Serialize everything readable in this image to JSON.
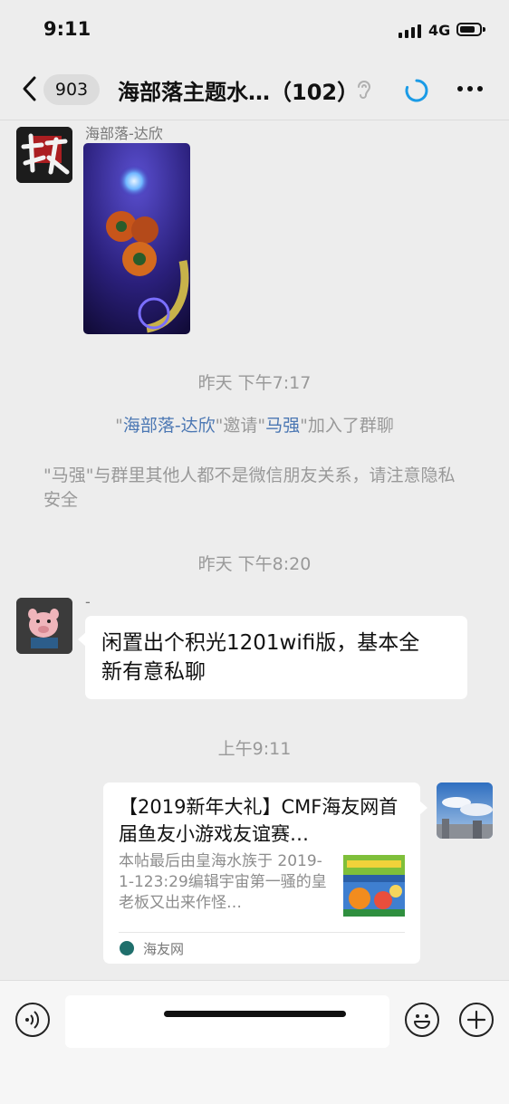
{
  "status_bar": {
    "time": "9:11",
    "network": "4G"
  },
  "nav": {
    "unread_badge": "903",
    "title": "海部落主题水…（102）"
  },
  "messages": {
    "photo": {
      "sender_name": "海部落-达欣"
    },
    "time_1": "昨天 下午7:17",
    "invite": {
      "quote_open": "\"",
      "inviter": "海部落-达欣",
      "mid": "\"邀请\"",
      "invitee": "马强",
      "tail": "\"加入了群聊"
    },
    "privacy_notice": "\"马强\"与群里其他人都不是微信朋友关系，请注意隐私安全",
    "time_2": "昨天 下午8:20",
    "text_msg": {
      "sender_name": "-",
      "text": "闲置出个积光1201wifi版，基本全新有意私聊"
    },
    "time_3": "上午9:11",
    "link_card": {
      "title": "【2019新年大礼】CMF海友网首届鱼友小游戏友谊赛…",
      "desc": "本帖最后由皇海水族于 2019-1-123:29编辑宇宙第一骚的皇老板又出来作怪…",
      "source": "海友网"
    }
  },
  "input": {
    "placeholder": ""
  },
  "colors": {
    "background": "#ededed",
    "link": "#4b77b3",
    "bubble": "#ffffff",
    "system_text": "#999999"
  },
  "icons": [
    "back-chevron-icon",
    "ear-icon",
    "loading-icon",
    "more-icon",
    "voice-icon",
    "emoji-icon",
    "add-icon"
  ]
}
